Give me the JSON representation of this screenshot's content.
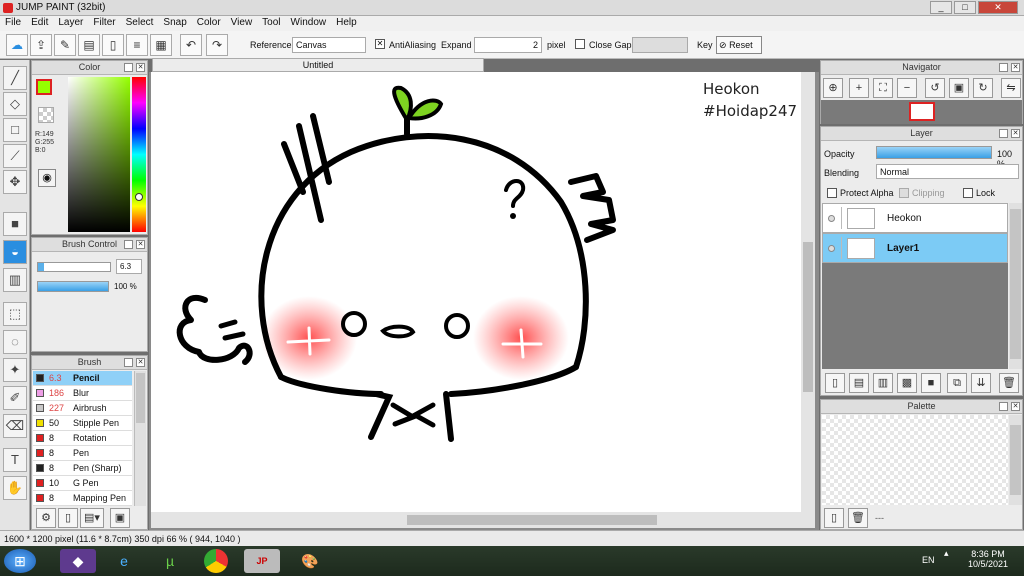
{
  "window": {
    "title": "JUMP PAINT (32bit)",
    "min": "_",
    "max": "□",
    "close": "✕"
  },
  "menu": [
    "File",
    "Edit",
    "Layer",
    "Filter",
    "Select",
    "Snap",
    "Color",
    "View",
    "Tool",
    "Window",
    "Help"
  ],
  "toolbar": {
    "reference_label": "Reference",
    "reference_value": "Canvas",
    "antialiasing_label": "AntiAliasing",
    "expand_label": "Expand",
    "expand_value": "2",
    "pixel_label": "pixel",
    "close_gaps_label": "Close Gaps",
    "key_label": "Key",
    "reset_label": "Reset"
  },
  "color_panel": {
    "title": "Color",
    "r": "R:149",
    "g": "G:255",
    "b": "B:0",
    "fg_color": "#95ff00"
  },
  "brush_control": {
    "title": "Brush Control",
    "size": "6.3",
    "opacity": "100 %",
    "opacity_level": 100
  },
  "brush_panel": {
    "title": "Brush",
    "items": [
      {
        "num": "6.3",
        "name": "Pencil",
        "color": "#222222",
        "selected": true
      },
      {
        "num": "186",
        "name": "Blur",
        "color": "#ee9ee6"
      },
      {
        "num": "227",
        "name": "Airbrush",
        "color": "#c8c8c8"
      },
      {
        "num": "50",
        "name": "Stipple Pen",
        "color": "#f0e000"
      },
      {
        "num": "8",
        "name": "Rotation Symm",
        "color": "#e02020"
      },
      {
        "num": "8",
        "name": "Pen",
        "color": "#e02020"
      },
      {
        "num": "8",
        "name": "Pen (Sharp)",
        "color": "#222222"
      },
      {
        "num": "10",
        "name": "G Pen",
        "color": "#e02020"
      },
      {
        "num": "8",
        "name": "Mapping Pen",
        "color": "#e02020"
      }
    ]
  },
  "document": {
    "tab": "Untitled",
    "watermark_line1": "Heokon",
    "watermark_line2": "#Hoidap247"
  },
  "navigator": {
    "title": "Navigator"
  },
  "layer_panel": {
    "title": "Layer",
    "opacity_label": "Opacity",
    "opacity_value": "100 %",
    "opacity_level": 100,
    "blending_label": "Blending",
    "blending_value": "Normal",
    "protect_alpha": "Protect Alpha",
    "clipping": "Clipping",
    "lock": "Lock",
    "layers": [
      {
        "name": "Heokon",
        "selected": false
      },
      {
        "name": "Layer1",
        "selected": true
      }
    ]
  },
  "palette": {
    "title": "Palette",
    "dots": "---"
  },
  "status": {
    "text": "1600 * 1200 pixel   (11.6 * 8.7cm)   350 dpi   66 %   ( 944, 1040 )"
  },
  "taskbar": {
    "lang": "EN",
    "time": "8:36 PM",
    "date": "10/5/2021"
  }
}
